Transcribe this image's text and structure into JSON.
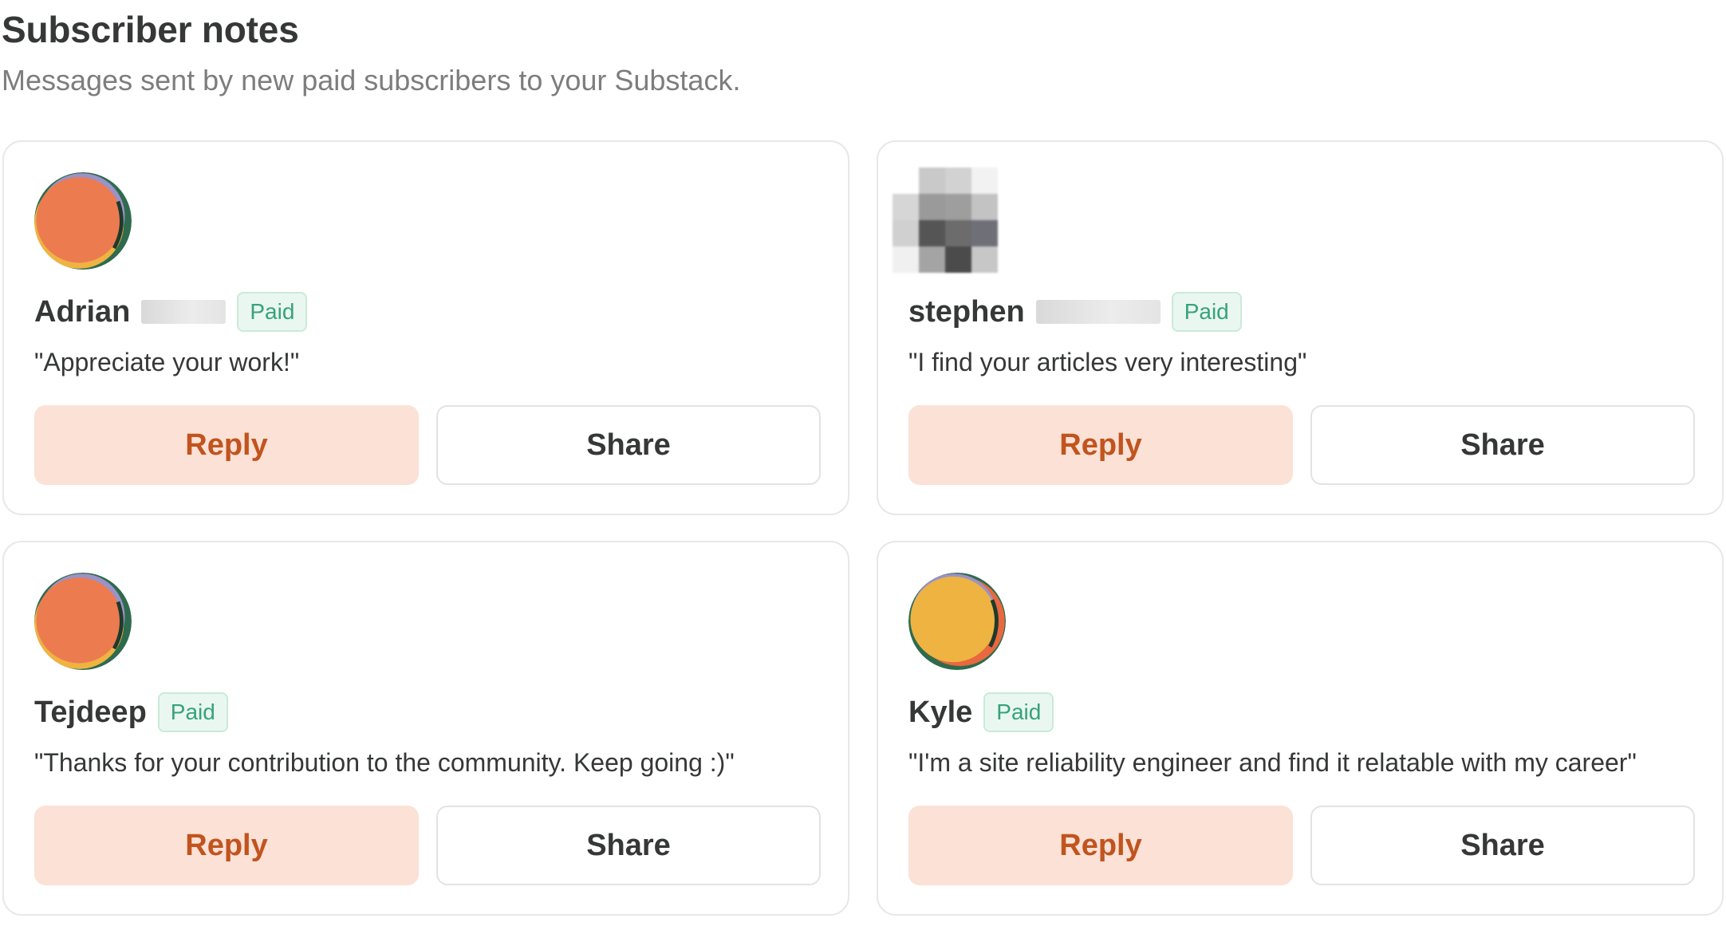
{
  "header": {
    "title": "Subscriber notes",
    "subtitle": "Messages sent by new paid subscribers to your Substack."
  },
  "notes": [
    {
      "name": "Adrian",
      "badge": "Paid",
      "message": "\"Appreciate your work!\"",
      "reply_label": "Reply",
      "share_label": "Share",
      "avatar": "orange-avatar-icon"
    },
    {
      "name": "stephen",
      "badge": "Paid",
      "message": "\"I find your articles very interesting\"",
      "reply_label": "Reply",
      "share_label": "Share",
      "avatar": "pixelated-avatar-icon"
    },
    {
      "name": "Tejdeep",
      "badge": "Paid",
      "message": "\"Thanks for your contribution to the community. Keep going :)\"",
      "reply_label": "Reply",
      "share_label": "Share",
      "avatar": "orange-avatar-icon"
    },
    {
      "name": "Kyle",
      "badge": "Paid",
      "message": "\"I'm a site reliability engineer and find it relatable with my career\"",
      "reply_label": "Reply",
      "share_label": "Share",
      "avatar": "yellow-avatar-icon"
    }
  ],
  "colors": {
    "reply_bg": "#fbe1d6",
    "reply_text": "#c1541e",
    "paid_badge_text": "#36a37a",
    "paid_badge_bg": "#eaf7f0"
  }
}
